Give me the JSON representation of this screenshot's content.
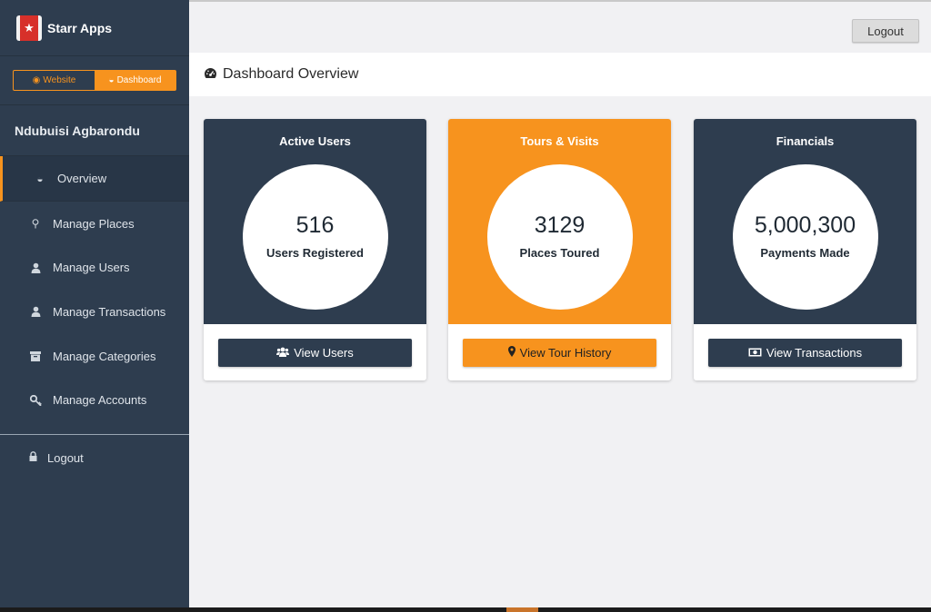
{
  "brand": {
    "name": "Starr Apps",
    "logo_icon": "star-icon"
  },
  "toggle": {
    "website_label": "Website",
    "dashboard_label": "Dashboard"
  },
  "user": {
    "name": "Ndubuisi Agbarondu"
  },
  "sidebar": {
    "items": [
      {
        "label": "Overview",
        "icon": "dashboard-icon"
      },
      {
        "label": "Manage Places",
        "icon": "map-marker-icon"
      },
      {
        "label": "Manage Users",
        "icon": "user-icon"
      },
      {
        "label": "Manage Transactions",
        "icon": "user-icon"
      },
      {
        "label": "Manage Categories",
        "icon": "archive-icon"
      },
      {
        "label": "Manage Accounts",
        "icon": "key-icon"
      }
    ],
    "logout_label": "Logout"
  },
  "topbar": {
    "logout_label": "Logout"
  },
  "page": {
    "title": "Dashboard Overview"
  },
  "cards": [
    {
      "title": "Active Users",
      "value": "516",
      "caption": "Users Registered",
      "button": "View Users",
      "button_icon": "users-icon",
      "color": "#2e3d4f"
    },
    {
      "title": "Tours & Visits",
      "value": "3129",
      "caption": "Places Toured",
      "button": "View Tour History",
      "button_icon": "map-marker-icon",
      "color": "#f7931e"
    },
    {
      "title": "Financials",
      "value": "5,000,300",
      "caption": "Payments Made",
      "button": "View Transactions",
      "button_icon": "money-icon",
      "color": "#2e3d4f"
    }
  ],
  "colors": {
    "sidebar": "#2e3d4f",
    "accent": "#f7931e",
    "background": "#f1f1f3"
  }
}
